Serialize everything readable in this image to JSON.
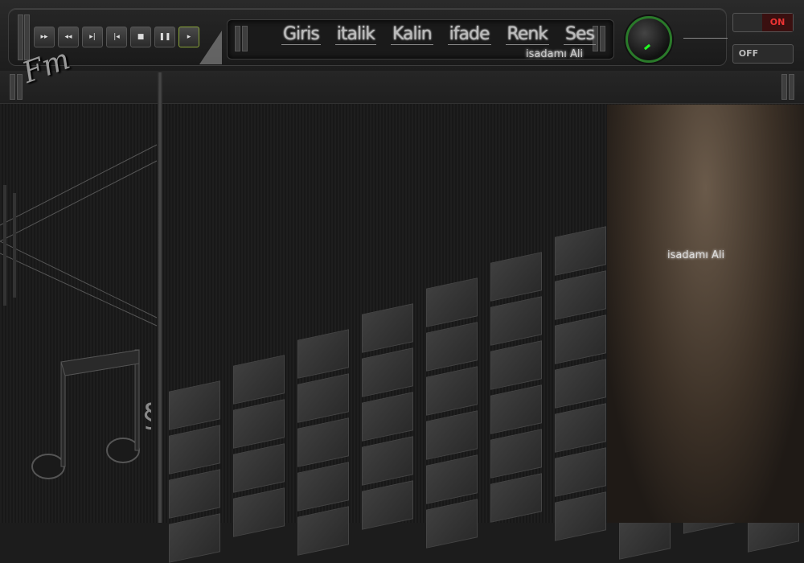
{
  "window": {
    "watermark": "isadamı Ali",
    "logo_text": "Fm"
  },
  "player": {
    "buttons": [
      {
        "name": "fast-forward",
        "glyph": "▸▸"
      },
      {
        "name": "rewind",
        "glyph": "◂◂"
      },
      {
        "name": "next",
        "glyph": "▸|"
      },
      {
        "name": "previous",
        "glyph": "|◂"
      },
      {
        "name": "stop",
        "glyph": "■"
      },
      {
        "name": "pause",
        "glyph": "❚❚"
      },
      {
        "name": "play",
        "glyph": "▸"
      }
    ]
  },
  "menu": {
    "items": [
      "Giris",
      "italik",
      "Kalin",
      "ifade",
      "Renk",
      "Ses"
    ]
  },
  "toggles": {
    "on_label": "ON",
    "off_label": "OFF"
  },
  "colors": {
    "accent_green": "#2f2",
    "on_red": "#e33",
    "bg": "#1c1c1c"
  }
}
